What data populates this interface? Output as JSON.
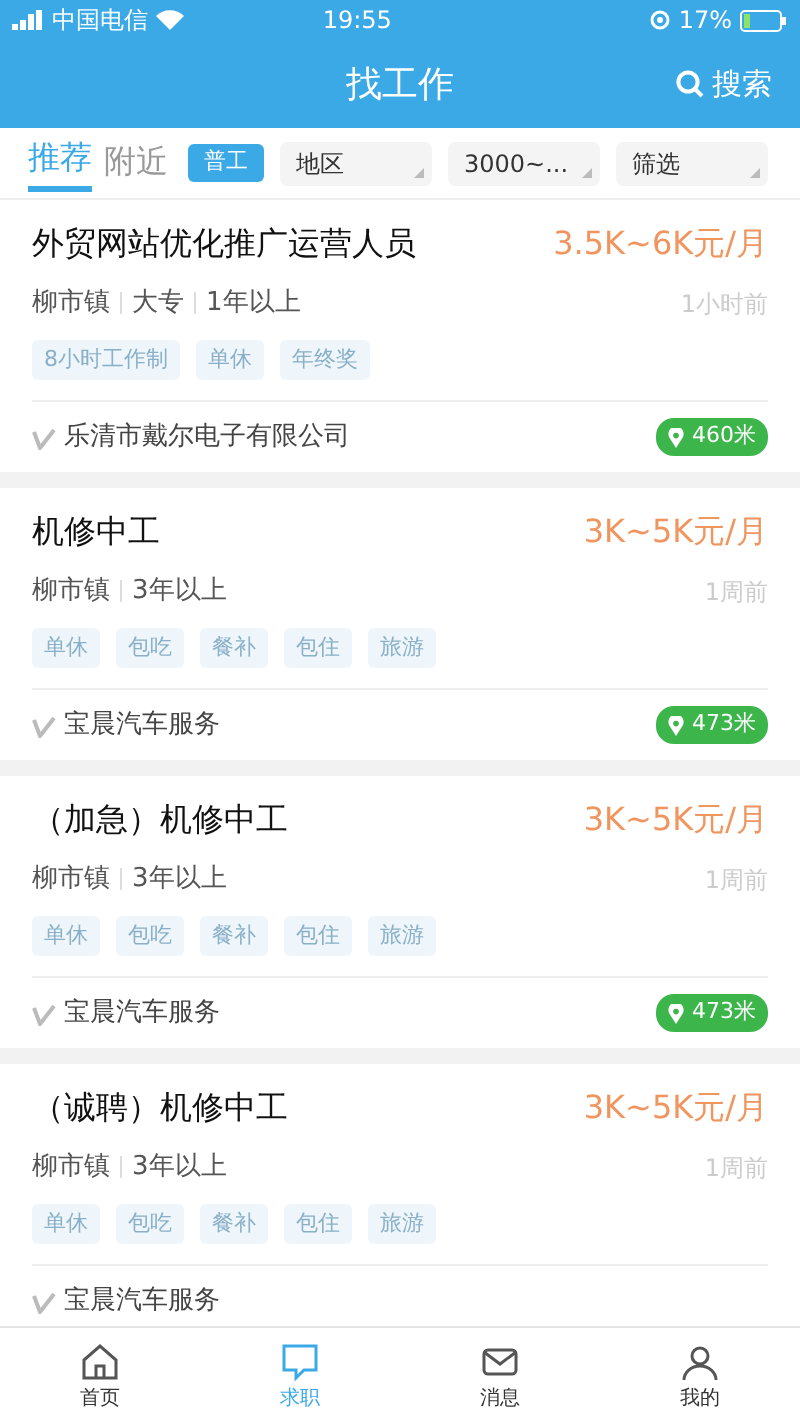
{
  "status_bar": {
    "carrier": "中国电信",
    "time": "19:55",
    "battery": "17%"
  },
  "header": {
    "title": "找工作",
    "search": "搜索"
  },
  "filters": {
    "tabs": [
      {
        "label": "推荐",
        "selected": true
      },
      {
        "label": "附近",
        "selected": false
      }
    ],
    "tag": "普工",
    "dropdowns": [
      "地区",
      "3000~...",
      "筛选"
    ]
  },
  "jobs": [
    {
      "title": "外贸网站优化推广运营人员",
      "salary": "3.5K~6K元/月",
      "meta": [
        "柳市镇",
        "大专",
        "1年以上"
      ],
      "time": "1小时前",
      "tags": [
        "8小时工作制",
        "单休",
        "年终奖"
      ],
      "company": "乐清市戴尔电子有限公司",
      "distance": "460米"
    },
    {
      "title": "机修中工",
      "salary": "3K~5K元/月",
      "meta": [
        "柳市镇",
        "3年以上"
      ],
      "time": "1周前",
      "tags": [
        "单休",
        "包吃",
        "餐补",
        "包住",
        "旅游"
      ],
      "company": "宝晨汽车服务",
      "distance": "473米"
    },
    {
      "title": "（加急）机修中工",
      "salary": "3K~5K元/月",
      "meta": [
        "柳市镇",
        "3年以上"
      ],
      "time": "1周前",
      "tags": [
        "单休",
        "包吃",
        "餐补",
        "包住",
        "旅游"
      ],
      "company": "宝晨汽车服务",
      "distance": "473米"
    },
    {
      "title": "（诚聘）机修中工",
      "salary": "3K~5K元/月",
      "meta": [
        "柳市镇",
        "3年以上"
      ],
      "time": "1周前",
      "tags": [
        "单休",
        "包吃",
        "餐补",
        "包住",
        "旅游"
      ],
      "company": "宝晨汽车服务"
    }
  ],
  "tab_bar": [
    {
      "label": "首页",
      "kind": "home",
      "selected": false
    },
    {
      "label": "求职",
      "kind": "chat",
      "selected": true
    },
    {
      "label": "消息",
      "kind": "message",
      "selected": false
    },
    {
      "label": "我的",
      "kind": "me",
      "selected": false
    }
  ]
}
